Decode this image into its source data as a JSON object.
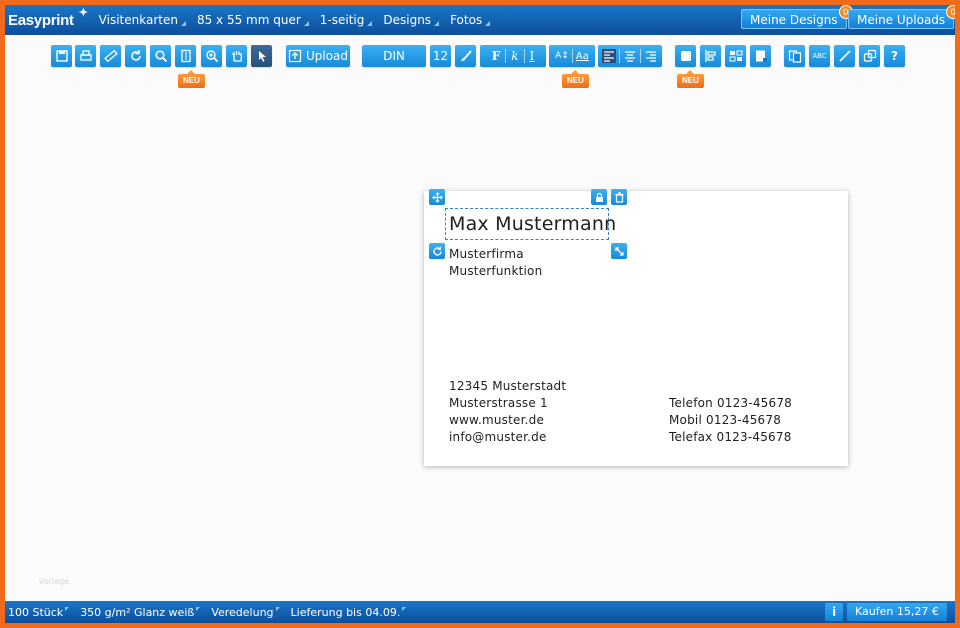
{
  "app": {
    "logo": "Easyprint"
  },
  "menu": [
    {
      "label": "Visitenkarten"
    },
    {
      "label": "85 x 55 mm quer"
    },
    {
      "label": "1-seitig"
    },
    {
      "label": "Designs"
    },
    {
      "label": "Fotos"
    }
  ],
  "header_buttons": {
    "my_designs": {
      "label": "Meine Designs",
      "count": "0"
    },
    "my_uploads": {
      "label": "Meine Uploads",
      "count": "0"
    }
  },
  "toolbar": {
    "upload_label": "Upload",
    "font_name": "DIN",
    "font_size": "12",
    "bold": "F",
    "italic": "k",
    "underline": "I",
    "case": "Aa",
    "spellcheck": "ABC",
    "help": "?",
    "new_badge": "NEU"
  },
  "card": {
    "name": "Max Mustermann",
    "company": "Musterfirma",
    "function": "Musterfunktion",
    "address": [
      "12345 Musterstadt",
      "Musterstrasse 1",
      "www.muster.de",
      "info@muster.de"
    ],
    "contact": [
      "Telefon 0123-45678",
      "Mobil 0123-45678",
      "Telefax 0123-45678"
    ]
  },
  "footer": {
    "quantity": "100 Stück",
    "paper": "350 g/m² Glanz weiß",
    "finishing": "Veredelung",
    "delivery": "Lieferung bis 04.09.",
    "info": "i",
    "buy": "Kaufen 15,27 €"
  },
  "watermark": "vorlage",
  "colors": {
    "accent": "#168ad9",
    "frame": "#f26a1b",
    "badge": "#f58a1f"
  }
}
